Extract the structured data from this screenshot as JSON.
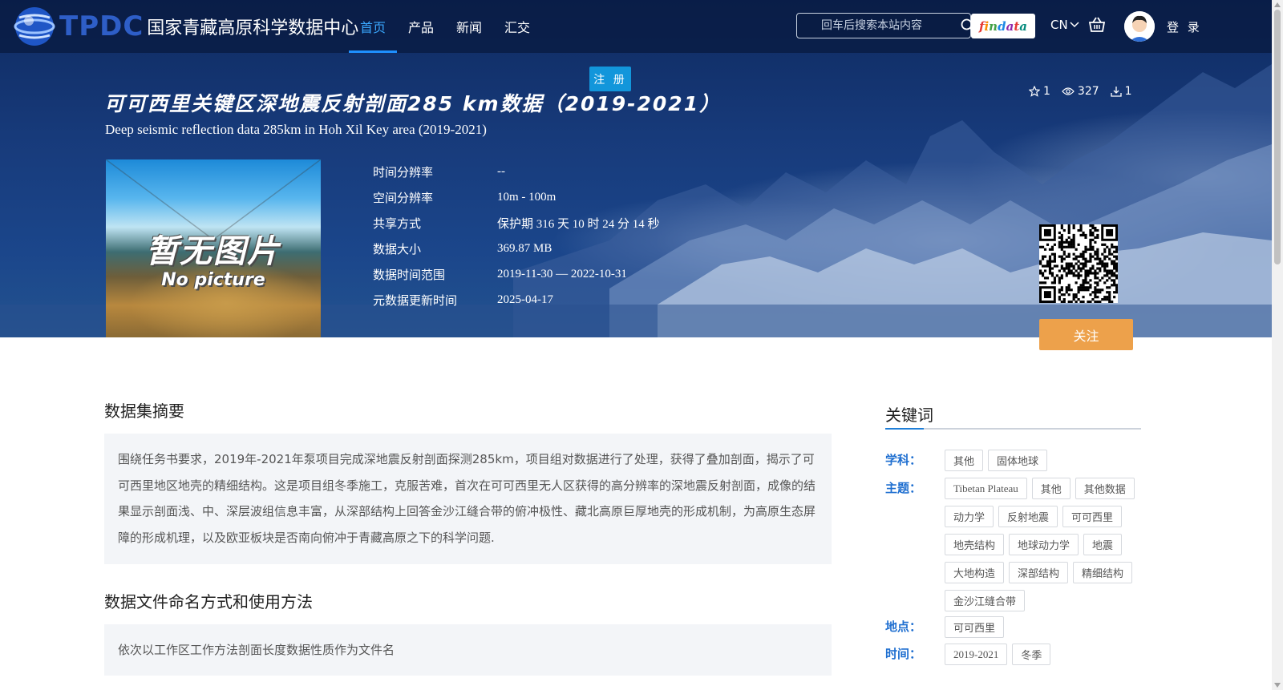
{
  "header": {
    "logo_mark": "TPDC",
    "logo_name": "国家青藏高原科学数据中心",
    "nav": [
      {
        "label": "首页",
        "active": true
      },
      {
        "label": "产品",
        "active": false
      },
      {
        "label": "新闻",
        "active": false
      },
      {
        "label": "汇交",
        "active": false
      }
    ],
    "search_placeholder": "回车后搜索本站内容",
    "findata_letters": [
      "f",
      "i",
      "n",
      "d",
      "a",
      "t",
      "a"
    ],
    "lang": "CN",
    "login": "登 录"
  },
  "hero": {
    "register": "注 册",
    "title": "可可西里关键区深地震反射剖面285 km数据（2019-2021）",
    "subtitle": "Deep seismic reflection data 285km in Hoh Xil Key area (2019-2021)",
    "stats": {
      "favorites": "1",
      "views": "327",
      "downloads": "1"
    },
    "thumb_cn": "暂无图片",
    "thumb_en": "No picture",
    "info": [
      {
        "label": "时间分辨率",
        "value": "--"
      },
      {
        "label": "空间分辨率",
        "value": "10m - 100m"
      },
      {
        "label": "共享方式",
        "value": "保护期 316 天 10 时 24 分 14 秒"
      },
      {
        "label": "数据大小",
        "value": "369.87 MB"
      },
      {
        "label": "数据时间范围",
        "value": "2019-11-30 — 2022-10-31"
      },
      {
        "label": "元数据更新时间",
        "value": "2025-04-17"
      }
    ],
    "follow": "关注"
  },
  "content": {
    "abstract_title": "数据集摘要",
    "abstract_text": "围绕任务书要求，2019年-2021年泵项目完成深地震反射剖面探测285km，项目组对数据进行了处理，获得了叠加剖面，揭示了可可西里地区地壳的精细结构。这是项目组冬季施工，克服苦难，首次在可可西里无人区获得的高分辨率的深地震反射剖面，成像的结果显示剖面浅、中、深层波组信息丰富，从深部结构上回答金沙江缝合带的俯冲极性、藏北高原巨厚地壳的形成机制，为高原生态屏障的形成机理，以及欧亚板块是否南向俯冲于青藏高原之下的科学问题.",
    "naming_title": "数据文件命名方式和使用方法",
    "naming_text": "依次以工作区工作方法剖面长度数据性质作为文件名"
  },
  "keywords": {
    "title": "关键词",
    "groups": [
      {
        "label": "学科：",
        "tags": [
          "其他",
          "固体地球"
        ]
      },
      {
        "label": "主题：",
        "tags": [
          "Tibetan Plateau",
          "其他",
          "其他数据",
          "动力学",
          "反射地震",
          "可可西里",
          "地壳结构",
          "地球动力学",
          "地震",
          "大地构造",
          "深部结构",
          "精细结构",
          "金沙江缝合带"
        ]
      },
      {
        "label": "地点：",
        "tags": [
          "可可西里"
        ]
      },
      {
        "label": "时间：",
        "tags": [
          "2019-2021",
          "冬季"
        ]
      }
    ]
  }
}
